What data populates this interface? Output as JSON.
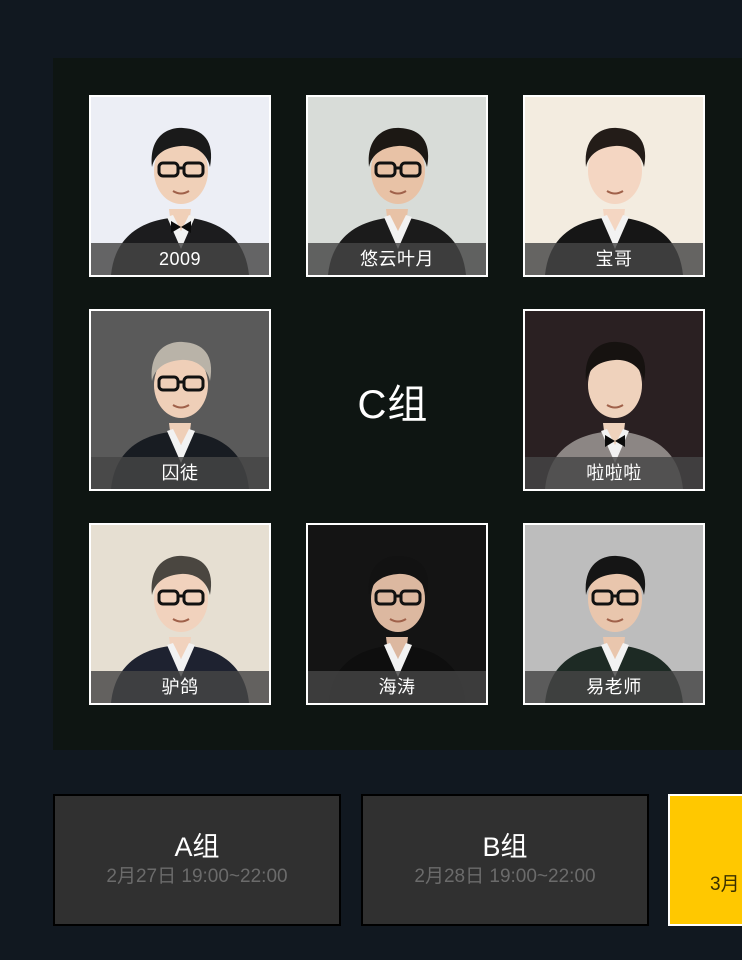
{
  "group_board": {
    "label": "C组",
    "players": [
      {
        "name": "2009",
        "bg": "#eceef5",
        "skin": "#f0d0b8",
        "hair": "#1a1a1a",
        "suit": "#1c1c1e",
        "glasses": true,
        "bow": true
      },
      {
        "name": "悠云叶月",
        "bg": "#d8dcd8",
        "skin": "#e8c2a6",
        "hair": "#1c1814",
        "suit": "#1b1b1b",
        "glasses": true,
        "bow": false
      },
      {
        "name": "宝哥",
        "bg": "#f3ece0",
        "skin": "#f4d6c2",
        "hair": "#231c18",
        "suit": "#161616",
        "glasses": false,
        "bow": false
      },
      {
        "name": "囚徒",
        "bg": "#5a5a5a",
        "skin": "#efcfb8",
        "hair": "#b9b3a8",
        "suit": "#181c22",
        "glasses": true,
        "bow": false
      },
      {
        "name": "啦啦啦",
        "bg": "#2a2022",
        "skin": "#efd2bc",
        "hair": "#161210",
        "suit": "#8c8684",
        "glasses": false,
        "bow": true
      },
      {
        "name": "驴鸽",
        "bg": "#e6dfd2",
        "skin": "#f1d2bd",
        "hair": "#4a4640",
        "suit": "#1e2230",
        "glasses": true,
        "bow": false
      },
      {
        "name": "海涛",
        "bg": "#141414",
        "skin": "#dcb8a0",
        "hair": "#121212",
        "suit": "#0e0e0e",
        "glasses": true,
        "bow": false
      },
      {
        "name": "易老师",
        "bg": "#bdbdbd",
        "skin": "#e9c6ad",
        "hair": "#151515",
        "suit": "#1d2a24",
        "glasses": true,
        "bow": false
      }
    ]
  },
  "schedule_tabs": [
    {
      "title": "A组",
      "time": "2月27日 19:00~22:00"
    },
    {
      "title": "B组",
      "time": "2月28日 19:00~22:00"
    },
    {
      "title": "",
      "time": "3月"
    }
  ],
  "colors": {
    "accent": "#ffc800",
    "page_bg": "#111820",
    "panel_bg": "#0e1512"
  }
}
